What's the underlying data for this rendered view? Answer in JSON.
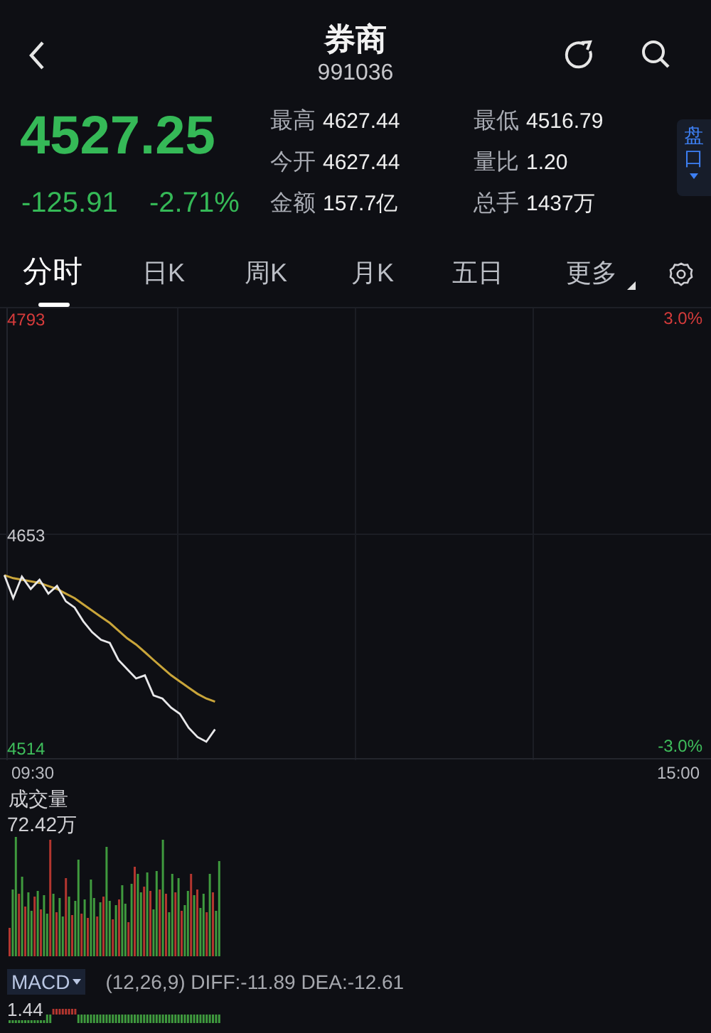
{
  "header": {
    "title": "券商",
    "code": "991036"
  },
  "quote": {
    "price": "4527.25",
    "change": "-125.91",
    "change_pct": "-2.71%"
  },
  "stats": [
    {
      "label": "最高",
      "value": "4627.44"
    },
    {
      "label": "最低",
      "value": "4516.79"
    },
    {
      "label": "今开",
      "value": "4627.44"
    },
    {
      "label": "量比",
      "value": "1.20"
    },
    {
      "label": "金额",
      "value": "157.7亿"
    },
    {
      "label": "总手",
      "value": "1437万"
    }
  ],
  "side_tab": {
    "label": "盘口"
  },
  "tabs": [
    {
      "label": "分时",
      "selected": true,
      "kind": "plain"
    },
    {
      "label": "日K",
      "selected": false,
      "kind": "plain"
    },
    {
      "label": "周K",
      "selected": false,
      "kind": "plain"
    },
    {
      "label": "月K",
      "selected": false,
      "kind": "plain"
    },
    {
      "label": "五日",
      "selected": false,
      "kind": "plain"
    },
    {
      "label": "更多",
      "selected": false,
      "kind": "dropdown"
    }
  ],
  "price_chart": {
    "chart_data": {
      "type": "line",
      "categories": [
        null,
        null,
        null,
        null,
        null,
        null,
        null,
        null,
        null,
        null,
        null,
        null,
        null,
        null,
        null,
        null,
        null,
        null,
        null,
        null,
        null,
        null,
        null,
        null,
        null,
        null,
        null,
        null,
        null,
        null,
        null,
        null,
        null,
        null,
        null,
        null,
        null,
        null,
        null,
        null,
        null,
        null,
        null,
        null,
        null,
        null,
        null,
        null,
        null,
        null,
        null,
        null,
        null,
        null,
        null,
        null,
        null,
        null,
        null,
        null,
        null,
        null,
        null,
        null,
        null,
        null,
        null,
        null,
        null,
        null,
        null,
        null,
        null,
        null,
        null,
        null,
        null,
        null,
        null,
        null,
        null
      ],
      "series": [
        {
          "color": "#e8e8ea",
          "values": [
            4627,
            4612,
            4626,
            4618,
            4624,
            4615,
            4620,
            4610,
            4606,
            4597,
            4590,
            4585,
            4583,
            4572,
            4566,
            4560,
            4562,
            4549,
            4547,
            4541,
            4537,
            4528,
            4522,
            4519,
            4527,
            null,
            null,
            null,
            null,
            null,
            null,
            null,
            null,
            null,
            null,
            null,
            null,
            null,
            null,
            null,
            null,
            null,
            null,
            null,
            null,
            null,
            null,
            null,
            null,
            null,
            null,
            null,
            null,
            null,
            null,
            null,
            null,
            null,
            null,
            null,
            null,
            null,
            null,
            null,
            null,
            null,
            null,
            null,
            null,
            null,
            null,
            null,
            null,
            null,
            null,
            null,
            null,
            null,
            null,
            null,
            null
          ]
        },
        {
          "color": "#c9a53a",
          "values": [
            4627,
            4625,
            4624,
            4623,
            4622,
            4620,
            4618,
            4615,
            4612,
            4608,
            4604,
            4600,
            4596,
            4591,
            4586,
            4582,
            4577,
            4572,
            4567,
            4562,
            4558,
            4554,
            4550,
            4547,
            4545,
            null,
            null,
            null,
            null,
            null,
            null,
            null,
            null,
            null,
            null,
            null,
            null,
            null,
            null,
            null,
            null,
            null,
            null,
            null,
            null,
            null,
            null,
            null,
            null,
            null,
            null,
            null,
            null,
            null,
            null,
            null,
            null,
            null,
            null,
            null,
            null,
            null,
            null,
            null,
            null,
            null,
            null,
            null,
            null,
            null,
            null,
            null,
            null,
            null,
            null,
            null,
            null,
            null,
            null,
            null,
            null
          ]
        }
      ],
      "ylim": [
        4507,
        4800
      ],
      "yticks": [
        {
          "value": 4793,
          "label": "4793"
        },
        {
          "value": 4653,
          "label": "4653"
        },
        {
          "value": 4514,
          "label": "4514"
        }
      ]
    },
    "percent_labels": [
      "3.0%",
      "-3.0%"
    ],
    "time_labels": [
      "09:30",
      "15:00"
    ]
  },
  "volume": {
    "label": "成交量",
    "max": "72.42万"
  },
  "macd": {
    "label": "MACD",
    "params": "(12,26,9) DIFF:-11.89 DEA:-12.61",
    "value": "1.44"
  }
}
